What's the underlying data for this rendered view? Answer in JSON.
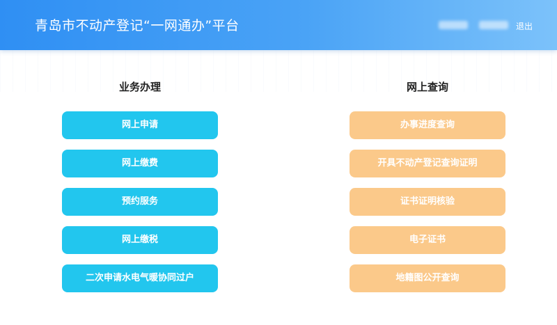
{
  "header": {
    "title": "青岛市不动产登记“一网通办”平台",
    "logout_label": "退出"
  },
  "left_panel": {
    "heading": "业务办理",
    "color": "#22c6ee",
    "items": [
      {
        "label": "网上申请"
      },
      {
        "label": "网上缴费"
      },
      {
        "label": "预约服务"
      },
      {
        "label": "网上缴税"
      },
      {
        "label": "二次申请水电气暖协同过户"
      }
    ]
  },
  "right_panel": {
    "heading": "网上查询",
    "color": "#fbc98a",
    "items": [
      {
        "label": "办事进度查询"
      },
      {
        "label": "开具不动产登记查询证明"
      },
      {
        "label": "证书证明核验"
      },
      {
        "label": "电子证书"
      },
      {
        "label": "地籍图公开查询"
      }
    ]
  }
}
